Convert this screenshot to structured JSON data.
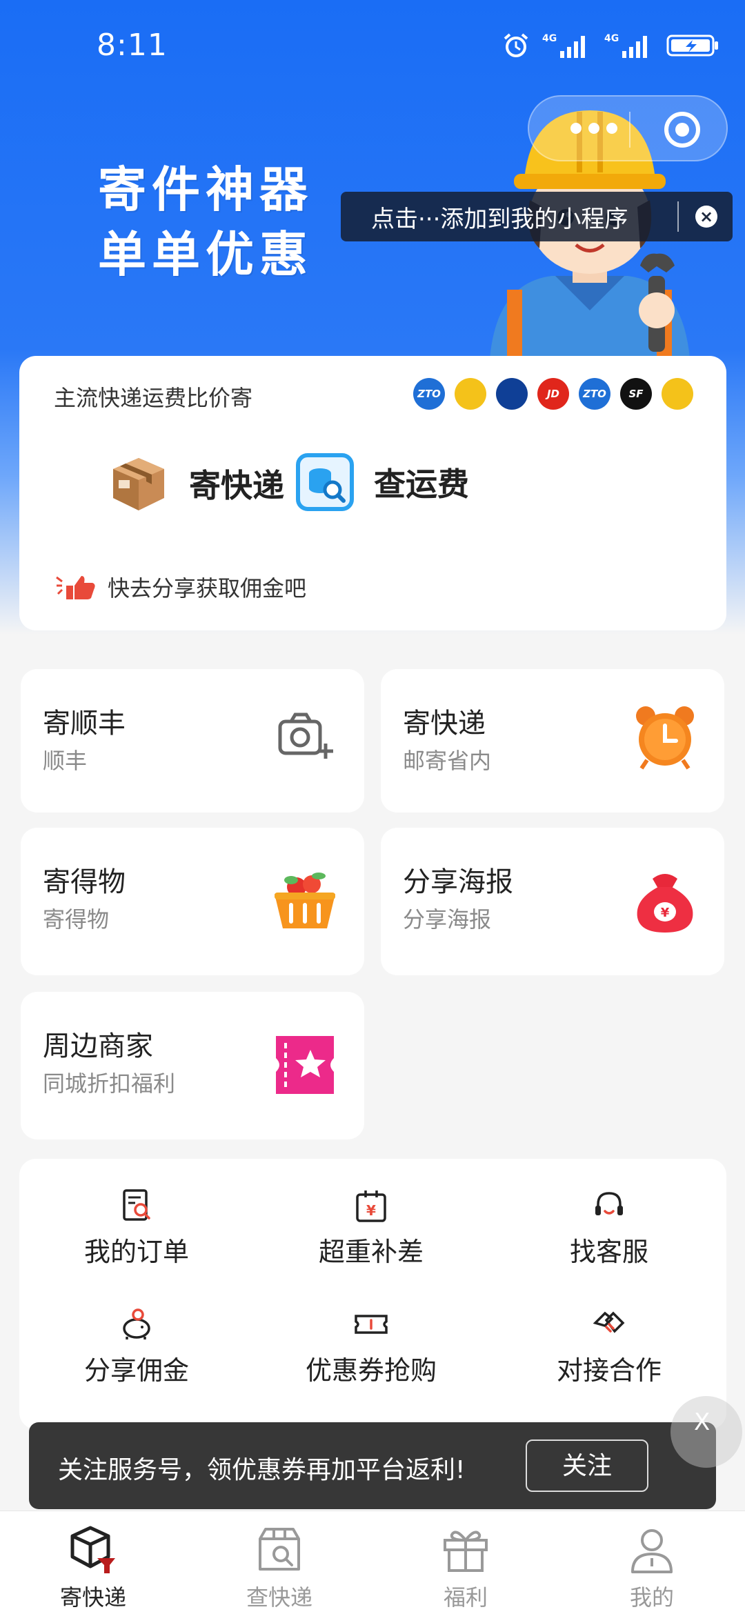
{
  "status_bar": {
    "time": "8:11",
    "network_1": "4G",
    "network_2": "4G"
  },
  "hero": {
    "slogan_line1": "寄件神器",
    "slogan_line2": "单单优惠",
    "tooltip": "点击···添加到我的小程序",
    "tooltip_close": "×"
  },
  "main_card": {
    "title": "主流快递运费比价寄",
    "carriers": [
      {
        "name": "ZTO",
        "label": "ZTO",
        "color": "#1f6fd6"
      },
      {
        "name": "Yunda",
        "label": "",
        "color": "#f4c21a"
      },
      {
        "name": "Best",
        "label": "",
        "color": "#0f3f96"
      },
      {
        "name": "JD",
        "label": "JD",
        "color": "#e0261b"
      },
      {
        "name": "ZTO",
        "label": "ZTO",
        "color": "#1f6fd6"
      },
      {
        "name": "SF",
        "label": "SF",
        "color": "#111111"
      },
      {
        "name": "Yunda",
        "label": "",
        "color": "#f4c21a"
      }
    ],
    "send_label": "寄快递",
    "check_label": "查运费",
    "share_text": "快去分享获取佣金吧"
  },
  "services": [
    {
      "title": "寄顺丰",
      "subtitle": "顺丰",
      "icon": "camera-plus-icon"
    },
    {
      "title": "寄快递",
      "subtitle": "邮寄省内",
      "icon": "alarm-clock-icon"
    },
    {
      "title": "寄得物",
      "subtitle": "寄得物",
      "icon": "fruit-basket-icon"
    },
    {
      "title": "分享海报",
      "subtitle": "分享海报",
      "icon": "money-bag-icon"
    },
    {
      "title": "周边商家",
      "subtitle": "同城折扣福利",
      "icon": "star-ticket-icon"
    }
  ],
  "grid": [
    {
      "label": "我的订单",
      "icon": "order-search-icon"
    },
    {
      "label": "超重补差",
      "icon": "price-diff-icon"
    },
    {
      "label": "找客服",
      "icon": "headset-icon"
    },
    {
      "label": "分享佣金",
      "icon": "piggy-bank-icon"
    },
    {
      "label": "优惠券抢购",
      "icon": "coupon-icon"
    },
    {
      "label": "对接合作",
      "icon": "handshake-icon"
    }
  ],
  "follow_bar": {
    "text": "关注服务号，领优惠券再加平台返利!",
    "button": "关注",
    "close": "X"
  },
  "tabbar": [
    {
      "label": "寄快递",
      "icon": "box-send-icon",
      "active": true
    },
    {
      "label": "查快递",
      "icon": "box-search-icon",
      "active": false
    },
    {
      "label": "福利",
      "icon": "gift-icon",
      "active": false
    },
    {
      "label": "我的",
      "icon": "person-icon",
      "active": false
    }
  ],
  "colors": {
    "brand_blue": "#1a6df5",
    "accent_red": "#e84a3a"
  }
}
